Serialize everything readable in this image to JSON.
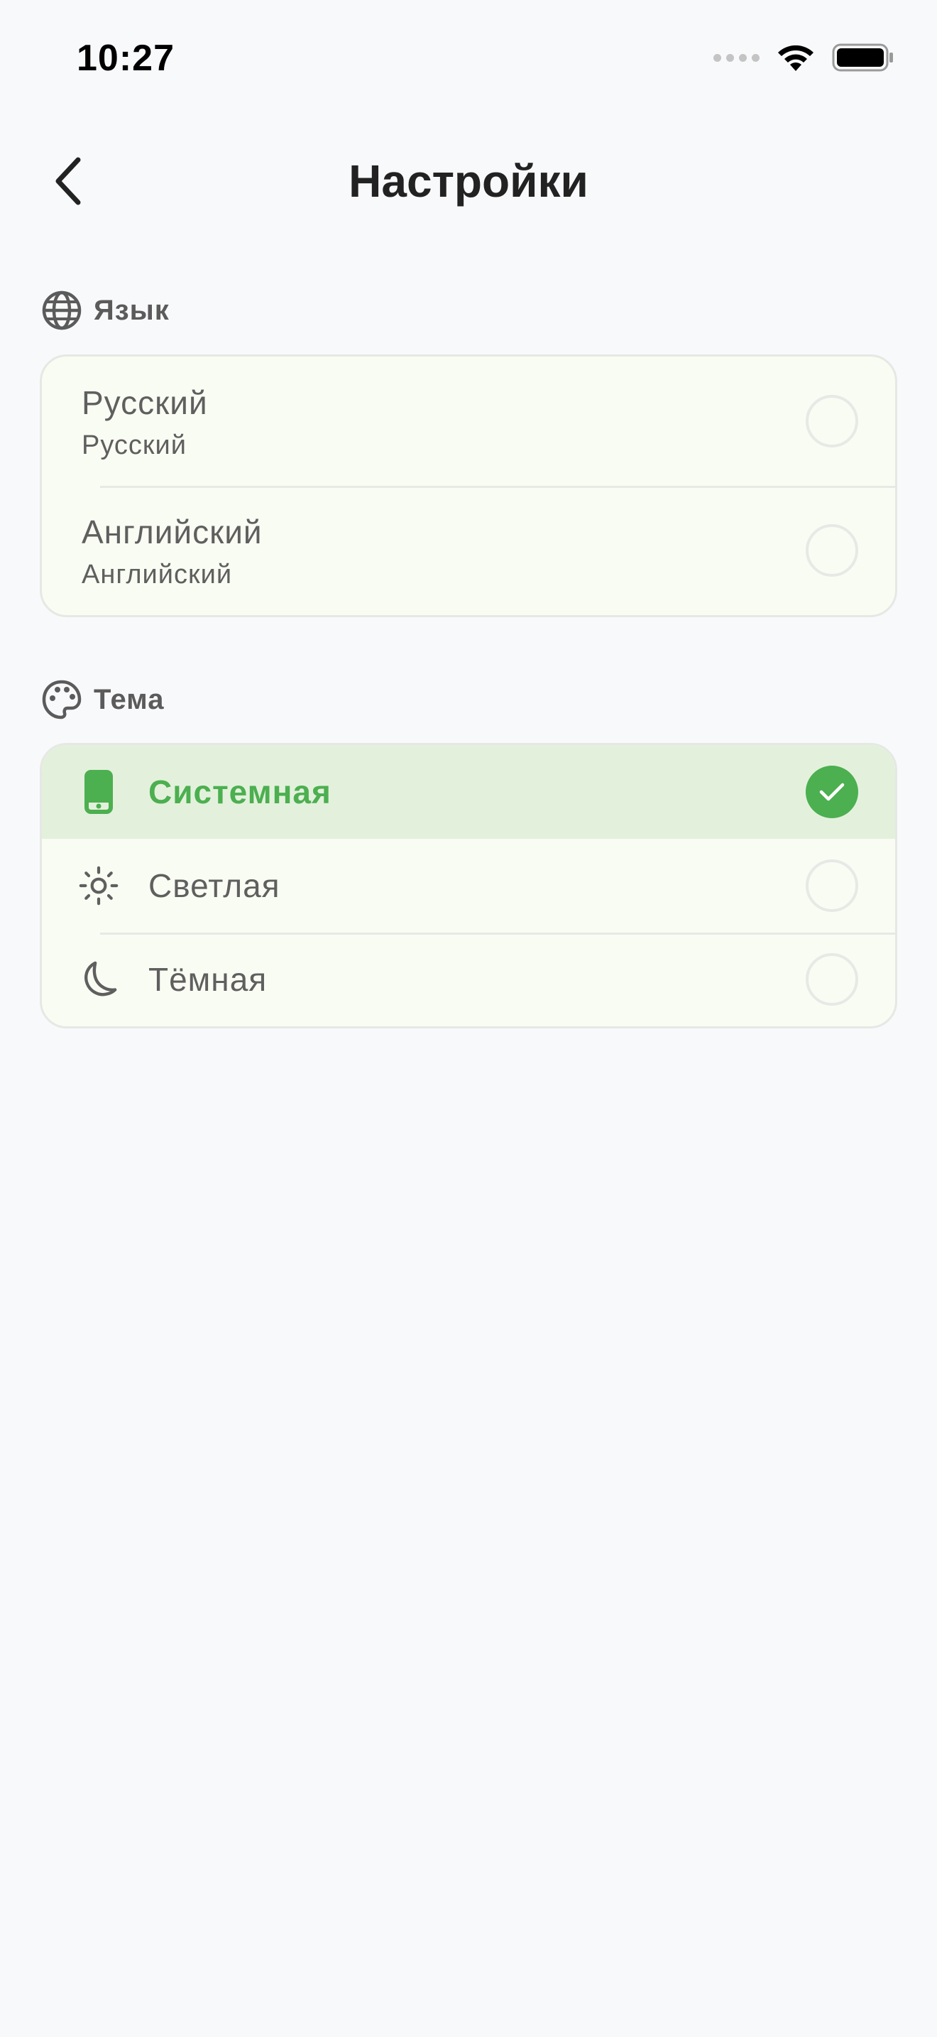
{
  "status_bar": {
    "time": "10:27",
    "icons": [
      "signal-icon",
      "wifi-icon",
      "battery-icon"
    ]
  },
  "header": {
    "title": "Настройки",
    "back_icon": "chevron-left-icon"
  },
  "language_section": {
    "heading": "Язык",
    "icon": "globe-icon",
    "options": [
      {
        "title": "Русский",
        "subtitle": "Русский",
        "selected": false
      },
      {
        "title": "Английский",
        "subtitle": "Английский",
        "selected": false
      }
    ]
  },
  "theme_section": {
    "heading": "Тема",
    "icon": "palette-icon",
    "options": [
      {
        "label": "Системная",
        "icon": "phone-icon",
        "selected": true
      },
      {
        "label": "Светлая",
        "icon": "sun-icon",
        "selected": false
      },
      {
        "label": "Тёмная",
        "icon": "moon-icon",
        "selected": false
      }
    ]
  },
  "colors": {
    "accent": "#4caf50",
    "selected_row_bg": "#e3f1dc",
    "card_bg": "#f9fcf3",
    "page_bg": "#f8f9fb"
  }
}
